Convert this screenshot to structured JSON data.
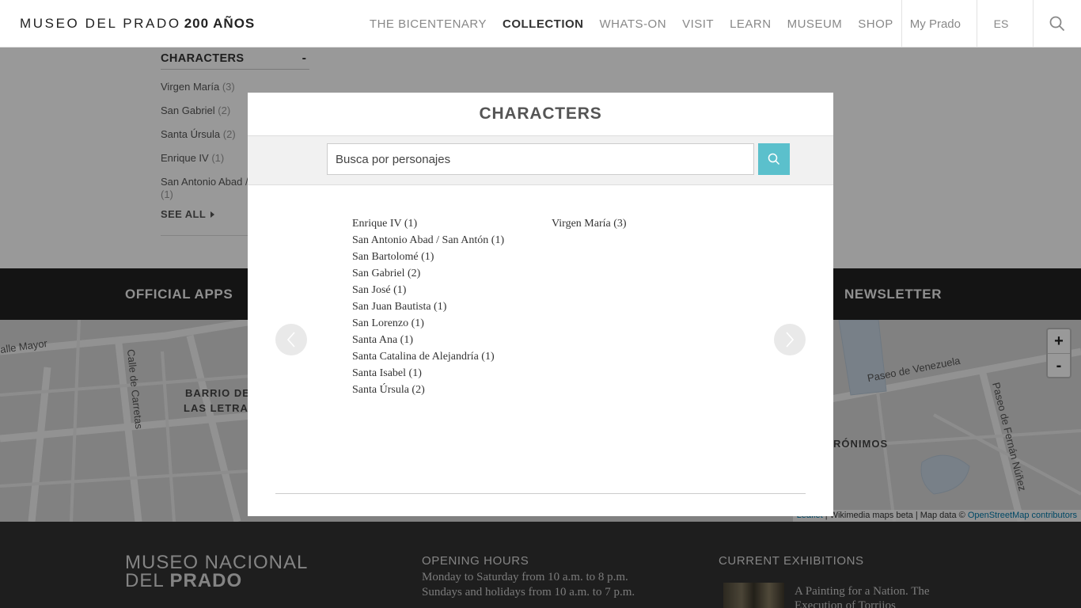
{
  "header": {
    "logo_main": "MUSEO DEL PRADO",
    "logo_bold": "200 AÑOS",
    "nav": [
      {
        "label": "THE BICENTENARY",
        "active": false
      },
      {
        "label": "COLLECTION",
        "active": true
      },
      {
        "label": "WHATS-ON",
        "active": false
      },
      {
        "label": "VISIT",
        "active": false
      },
      {
        "label": "LEARN",
        "active": false
      },
      {
        "label": "MUSEUM",
        "active": false
      },
      {
        "label": "SHOP",
        "active": false
      }
    ],
    "my_prado": "My Prado",
    "language": "ES",
    "search_icon": "search-icon"
  },
  "sidebar": {
    "title": "CHARACTERS",
    "toggle": "-",
    "items": [
      {
        "name": "Virgen María",
        "count": "(3)"
      },
      {
        "name": "San Gabriel",
        "count": "(2)"
      },
      {
        "name": "Santa Úrsula",
        "count": "(2)"
      },
      {
        "name": "Enrique IV",
        "count": "(1)"
      },
      {
        "name": "San Antonio Abad / San Antón",
        "count": "(1)"
      }
    ],
    "see_all": "SEE ALL"
  },
  "apps_bar": {
    "official_apps": "OFFICIAL APPS",
    "newsletter": "NEWSLETTER"
  },
  "map": {
    "labels": {
      "calle_mayor": "alle Mayor",
      "calle_carretas": "Calle de Carretas",
      "barrio_1": "BARRIO DE",
      "barrio_2": "LAS LETRA",
      "jeronimos": "RÓNIMOS",
      "paseo_venezuela": "Paseo de Venezuela",
      "paseo_fernan": "Paseo de Fernán Núñez"
    },
    "zoom_in": "+",
    "zoom_out": "-",
    "attribution_leaflet": "Leaflet",
    "attribution_text": " | Wikimedia maps beta | Map data © ",
    "attribution_osm": "OpenStreetMap contributors"
  },
  "footer": {
    "logo_line1": "MUSEO NACIONAL",
    "logo_line2_plain": "DEL ",
    "logo_line2_bold": "PRADO",
    "opening_hours_title": "OPENING HOURS",
    "hours_line1": "Monday to Saturday from 10 a.m. to 8 p.m.",
    "hours_line2": "Sundays and holidays from 10 a.m. to 7 p.m.",
    "exhibitions_title": "CURRENT EXHIBITIONS",
    "exhibition_title": "A Painting for a Nation. The Execution of Torrijos"
  },
  "modal": {
    "title": "CHARACTERS",
    "search_placeholder": "Busca por personajes",
    "search_value": "",
    "column_1": [
      "Enrique IV (1)",
      "San Antonio Abad / San Antón  (1)",
      "San Bartolomé (1)",
      "San Gabriel (2)",
      "San José (1)",
      "San Juan Bautista (1)",
      "San Lorenzo (1)",
      "Santa Ana (1)",
      "Santa Catalina de Alejandría (1)",
      "Santa Isabel (1)",
      "Santa Úrsula (2)"
    ],
    "column_2": [
      "Virgen María (3)"
    ],
    "prev_icon": "chevron-left-icon",
    "next_icon": "chevron-right-icon"
  },
  "colors": {
    "search_button": "#5bc0cc",
    "overlay": "rgba(0,0,0,0.4)",
    "apps_bar": "#222222",
    "footer": "#333333"
  }
}
